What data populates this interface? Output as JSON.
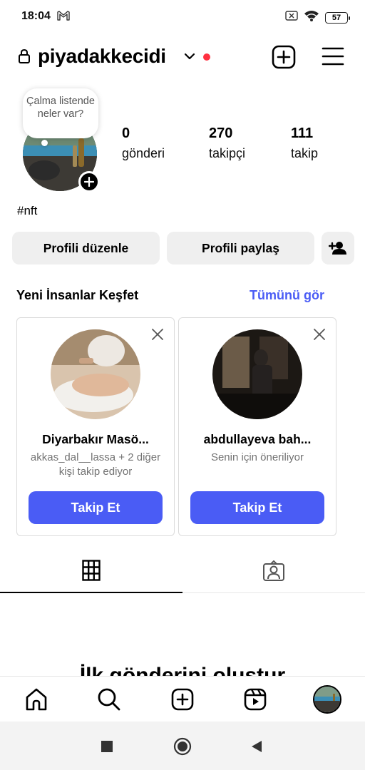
{
  "status_bar": {
    "time": "18:04",
    "battery": "57"
  },
  "header": {
    "username": "piyadakkecidi"
  },
  "note": {
    "text": "Çalma listende neler var?"
  },
  "stats": [
    {
      "value": "0",
      "label": "gönderi"
    },
    {
      "value": "270",
      "label": "takipçi"
    },
    {
      "value": "111",
      "label": "takip"
    }
  ],
  "bio": "#nft",
  "buttons": {
    "edit_profile": "Profili düzenle",
    "share_profile": "Profili paylaş"
  },
  "discover": {
    "title": "Yeni İnsanlar Keşfet",
    "see_all": "Tümünü gör",
    "cards": [
      {
        "name": "Diyarbakır Masö...",
        "subtitle": "akkas_dal__lassa + 2 diğer kişi takip ediyor",
        "button": "Takip Et"
      },
      {
        "name": "abdullayeva  bah...",
        "subtitle": "Senin için öneriliyor",
        "button": "Takip Et"
      }
    ]
  },
  "empty_state": {
    "title": "İlk gönderini oluştur"
  },
  "colors": {
    "accent": "#4a5cf5",
    "notification": "#ff3040",
    "button_bg": "#efefef"
  }
}
